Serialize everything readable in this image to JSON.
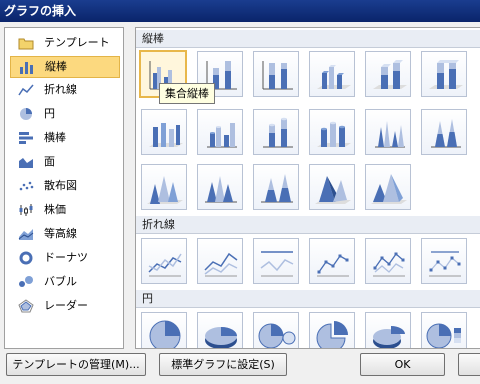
{
  "window": {
    "title": "グラフの挿入"
  },
  "sidebar": {
    "items": [
      {
        "label": "テンプレート",
        "icon": "folder-icon"
      },
      {
        "label": "縦棒",
        "icon": "column-chart-icon",
        "selected": true
      },
      {
        "label": "折れ線",
        "icon": "line-chart-icon"
      },
      {
        "label": "円",
        "icon": "pie-chart-icon"
      },
      {
        "label": "横棒",
        "icon": "bar-chart-icon"
      },
      {
        "label": "面",
        "icon": "area-chart-icon"
      },
      {
        "label": "散布図",
        "icon": "scatter-chart-icon"
      },
      {
        "label": "株価",
        "icon": "stock-chart-icon"
      },
      {
        "label": "等高線",
        "icon": "surface-chart-icon"
      },
      {
        "label": "ドーナツ",
        "icon": "doughnut-chart-icon"
      },
      {
        "label": "バブル",
        "icon": "bubble-chart-icon"
      },
      {
        "label": "レーダー",
        "icon": "radar-chart-icon"
      }
    ]
  },
  "gallery": {
    "sections": [
      {
        "title": "縦棒"
      },
      {
        "title": "折れ線"
      },
      {
        "title": "円"
      }
    ],
    "tooltip": "集合縦棒"
  },
  "buttons": {
    "manage_templates": "テンプレートの管理(M)...",
    "set_default": "標準グラフに設定(S)",
    "ok": "OK"
  },
  "colors": {
    "accent": "#fcd97f",
    "chart_blue": "#4a6fb5",
    "chart_light": "#aebfe0"
  }
}
